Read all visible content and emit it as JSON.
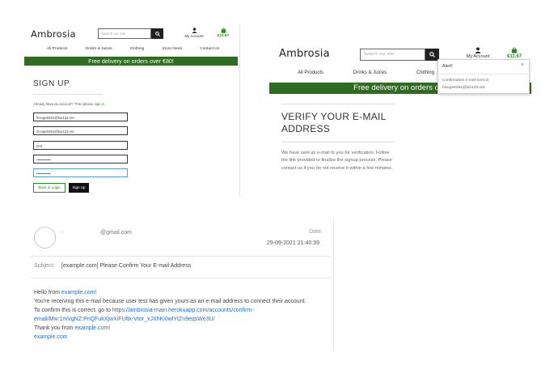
{
  "signup": {
    "logo": "Ambrosia",
    "search_placeholder": "Search our site",
    "account_label": "My Account",
    "bag_total": "€11.67",
    "nav": [
      "All Products",
      "Drinks & Juices",
      "Clothing",
      "Store News",
      "Contact Us"
    ],
    "banner": "Free delivery on orders over €80!",
    "title": "SIGN UP",
    "note_prefix": "Already have an account? Then please ",
    "note_link": "sign in.",
    "fields": [
      "hivoge6381@bio123.net",
      "hivoge6381@bio123.net",
      "test",
      "••••••••••••",
      "•••••••••••|"
    ],
    "back_button": "Back to Login",
    "signup_button": "Sign Up"
  },
  "verify": {
    "logo": "Ambrosia",
    "search_placeholder": "Search our site",
    "account_label": "My Account",
    "bag_total": "€11.67",
    "nav": [
      "All Products",
      "Drinks & Juices",
      "Clothing",
      "S"
    ],
    "banner": "Free delivery on orders ove",
    "title": "VERIFY YOUR E-MAIL ADDRESS",
    "paragraph": "We have sent an e-mail to you for verification. Follow the link provided to finalize the signup process. Please contact us if you do not receive it within a few minutes.",
    "alert": {
      "title": "Alert!",
      "close": "×",
      "message": "Confirmation e-mail sent to hivoge6381@bio123.net."
    }
  },
  "email": {
    "sender_name": "-",
    "sender": "@gmail.com",
    "date_label": "Date:",
    "date_value": "29-09-2021 21:40:39",
    "subject_label": "Subject:",
    "subject_value": "[example.com] Please Confirm Your E-mail Address",
    "hello_prefix": "Hello from ",
    "site": "example.com",
    "site_bang": "example.com!",
    "line2": "You're receiving this e-mail because user test has given yours as an e-mail address to connect their account.",
    "line3_prefix": "To confirm this is correct, go to ",
    "confirm_link": "https://ambrosia-main.herokuapp.com/accounts/confirm-email/Mw:1mVgNZ:PnQFukXjwXiFUftx-Vtor_xJXhKi0wlYtZn9eqsWe3U/",
    "thanks_prefix": "Thank you from ",
    "footer_site": "example.com"
  },
  "colors": {
    "brand_green": "#2f6b20",
    "link_blue": "#1f6fd1",
    "bag_green": "#2b8a1f"
  },
  "icons": [
    "search-icon",
    "user-icon",
    "shopping-bag-icon",
    "close-icon"
  ]
}
